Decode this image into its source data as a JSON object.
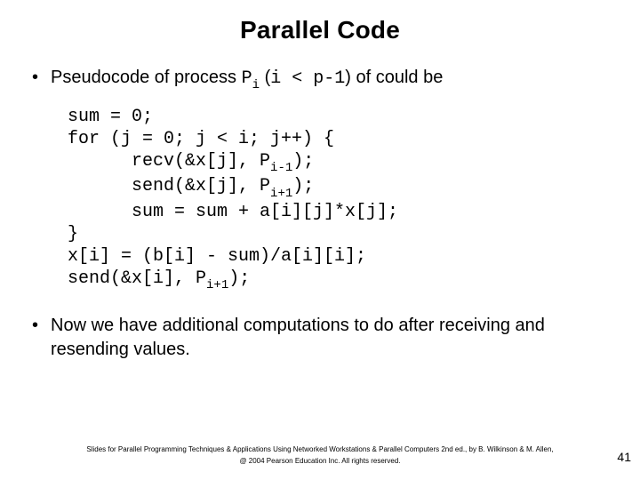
{
  "title": "Parallel Code",
  "intro": {
    "pre": "Pseudocode of process ",
    "p": "P",
    "i": "i",
    "mid": " (",
    "cond": "i < p-1",
    "post": ") of could be"
  },
  "code": {
    "l1": "sum = 0;",
    "l2": "for (j = 0; j < i; j++) {",
    "l3a": "      recv(&x[j], P",
    "l3b": "i-1",
    "l3c": ");",
    "l4a": "      send(&x[j], P",
    "l4b": "i+1",
    "l4c": ");",
    "l5": "      sum = sum + a[i][j]*x[j];",
    "l6": "}",
    "l7": "x[i] = (b[i] - sum)/a[i][i];",
    "l8a": "send(&x[i], P",
    "l8b": "i+1",
    "l8c": ");"
  },
  "bullet2": "Now we have additional computations to do after receiving and resending values.",
  "footer": {
    "line1": "Slides for Parallel Programming Techniques & Applications Using Networked Workstations & Parallel Computers 2nd ed., by B. Wilkinson & M. Allen,",
    "line2": "@ 2004 Pearson Education Inc. All rights reserved."
  },
  "pagenum": "41"
}
